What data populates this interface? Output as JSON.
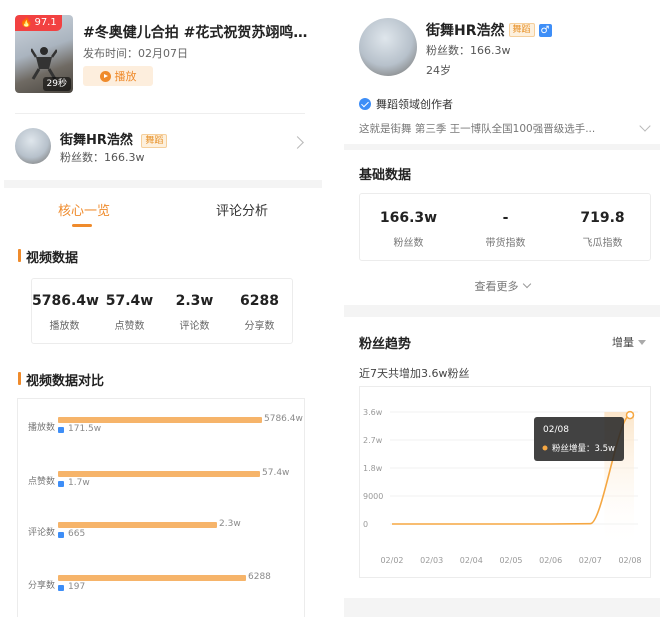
{
  "video": {
    "heat_score": "97.1",
    "duration": "29秒",
    "title": "#冬奥健儿合拍 #花式祝贺苏翊鸣 真...",
    "publish_time": "发布时间：02月07日",
    "play_label": "播放"
  },
  "author": {
    "name": "街舞HR浩然",
    "tag": "舞蹈",
    "fans": "粉丝数：166.3w",
    "gender_symbol": "♂",
    "age": "24岁",
    "creator_field": "舞蹈领域创作者",
    "bio": "这就是街舞 第三季 王一博队全国100强晋级选手..."
  },
  "tabs": [
    {
      "label": "核心一览",
      "active": true
    },
    {
      "label": "评论分析",
      "active": false
    }
  ],
  "video_data": {
    "title": "视频数据",
    "stats": [
      {
        "value": "5786.4w",
        "label": "播放数"
      },
      {
        "value": "57.4w",
        "label": "点赞数"
      },
      {
        "value": "2.3w",
        "label": "评论数"
      },
      {
        "value": "6288",
        "label": "分享数"
      }
    ]
  },
  "comparison": {
    "title": "视频数据对比",
    "rows": [
      {
        "label": "播放数",
        "a_label": "5786.4w",
        "a": 57864000,
        "b_label": "171.5w",
        "b": 1715000
      },
      {
        "label": "点赞数",
        "a_label": "57.4w",
        "a": 574000,
        "b_label": "1.7w",
        "b": 17000
      },
      {
        "label": "评论数",
        "a_label": "2.3w",
        "a": 23000,
        "b_label": "665",
        "b": 665
      },
      {
        "label": "分享数",
        "a_label": "6288",
        "a": 6288,
        "b_label": "197",
        "b": 197
      }
    ],
    "bar_fraction_a": [
      1.0,
      0.99,
      0.78,
      0.92
    ],
    "bar_fraction_b": [
      0.03,
      0.03,
      0.03,
      0.03
    ],
    "colors": {
      "a": "#f6b46a",
      "b": "#3e8ef7"
    }
  },
  "base_data": {
    "title": "基础数据",
    "stats": [
      {
        "value": "166.3w",
        "label": "粉丝数"
      },
      {
        "value": "-",
        "label": "带货指数"
      },
      {
        "value": "719.8",
        "label": "飞瓜指数"
      }
    ],
    "more_label": "查看更多"
  },
  "fans_trend": {
    "title": "粉丝趋势",
    "metric": "增量",
    "summary": "近7天共增加3.6w粉丝",
    "tooltip": {
      "date": "02/08",
      "label": "粉丝增量：3.5w"
    }
  },
  "chart_data": {
    "type": "line",
    "x": [
      "02/02",
      "02/03",
      "02/04",
      "02/05",
      "02/06",
      "02/07",
      "02/08"
    ],
    "series": [
      {
        "name": "粉丝增量",
        "values": [
          0,
          0,
          0,
          0,
          0,
          0.01,
          3.5
        ]
      }
    ],
    "y_tick_labels": [
      "3.6w",
      "2.7w",
      "1.8w",
      "9000",
      "0"
    ],
    "ylim": [
      0,
      3.6
    ],
    "y_unit": "w",
    "grid": true,
    "color": "#f5a742"
  },
  "accent_color": "#ef8b2c"
}
